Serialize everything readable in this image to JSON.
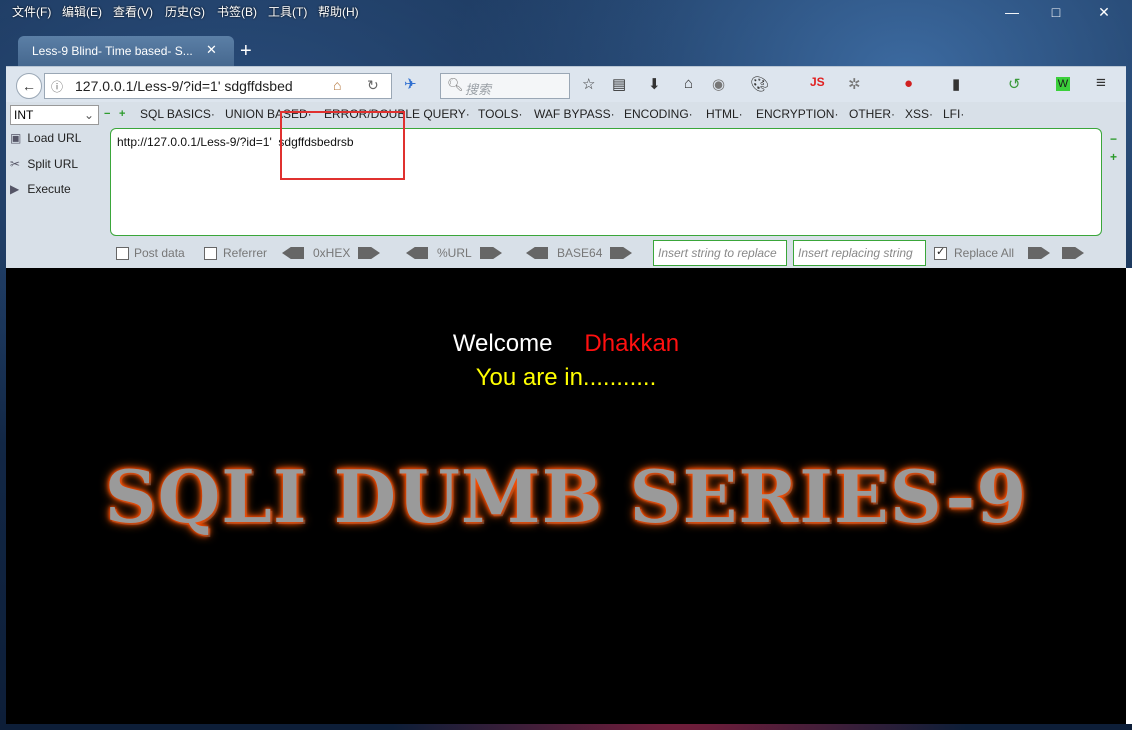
{
  "menubar": {
    "items": [
      "文件(F)",
      "编辑(E)",
      "查看(V)",
      "历史(S)",
      "书签(B)",
      "工具(T)",
      "帮助(H)"
    ],
    "window_controls": [
      "—",
      "□",
      "✕"
    ]
  },
  "tab": {
    "title": "Less-9 Blind- Time based- S...",
    "close": "✕",
    "new_tab": "+"
  },
  "navbar": {
    "url": "127.0.0.1/Less-9/?id=1'  sdgffdsbed",
    "search_placeholder": "搜索",
    "toolbar_icons": [
      "star-icon",
      "reading-list-icon",
      "download-icon",
      "home-icon",
      "addon-icon",
      "palette-icon",
      "js-icon",
      "spider-icon",
      "record-icon",
      "stats-icon",
      "shield-icon",
      "menu-icon"
    ]
  },
  "hackbar": {
    "select_value": "INT",
    "menu": [
      "SQL BASICS·",
      "UNION BASED·",
      "ERROR/DOUBLE QUERY·",
      "TOOLS·",
      "WAF BYPASS·",
      "ENCODING·",
      "HTML·",
      "ENCRYPTION·",
      "OTHER·",
      "XSS·",
      "LFI·"
    ],
    "side": [
      "Load URL",
      "Split URL",
      "Execute"
    ],
    "textarea": "http://127.0.0.1/Less-9/?id=1'  sdgffdsbedrsb",
    "bottom": {
      "post_data": "Post data",
      "referrer": "Referrer",
      "hex": "0xHEX",
      "url": "%URL",
      "base64": "BASE64",
      "insert_replace": "Insert string to replace",
      "insert_replacing": "Insert replacing string",
      "replace_all": "Replace All"
    }
  },
  "page": {
    "welcome": "Welcome",
    "name": "Dhakkan",
    "status": "You are in...........",
    "banner": "SQLI DUMB SERIES-9"
  },
  "colors": {
    "welcome_name": "#ff1010",
    "status": "#ffff00",
    "banner_glow": "#ff4a00"
  }
}
